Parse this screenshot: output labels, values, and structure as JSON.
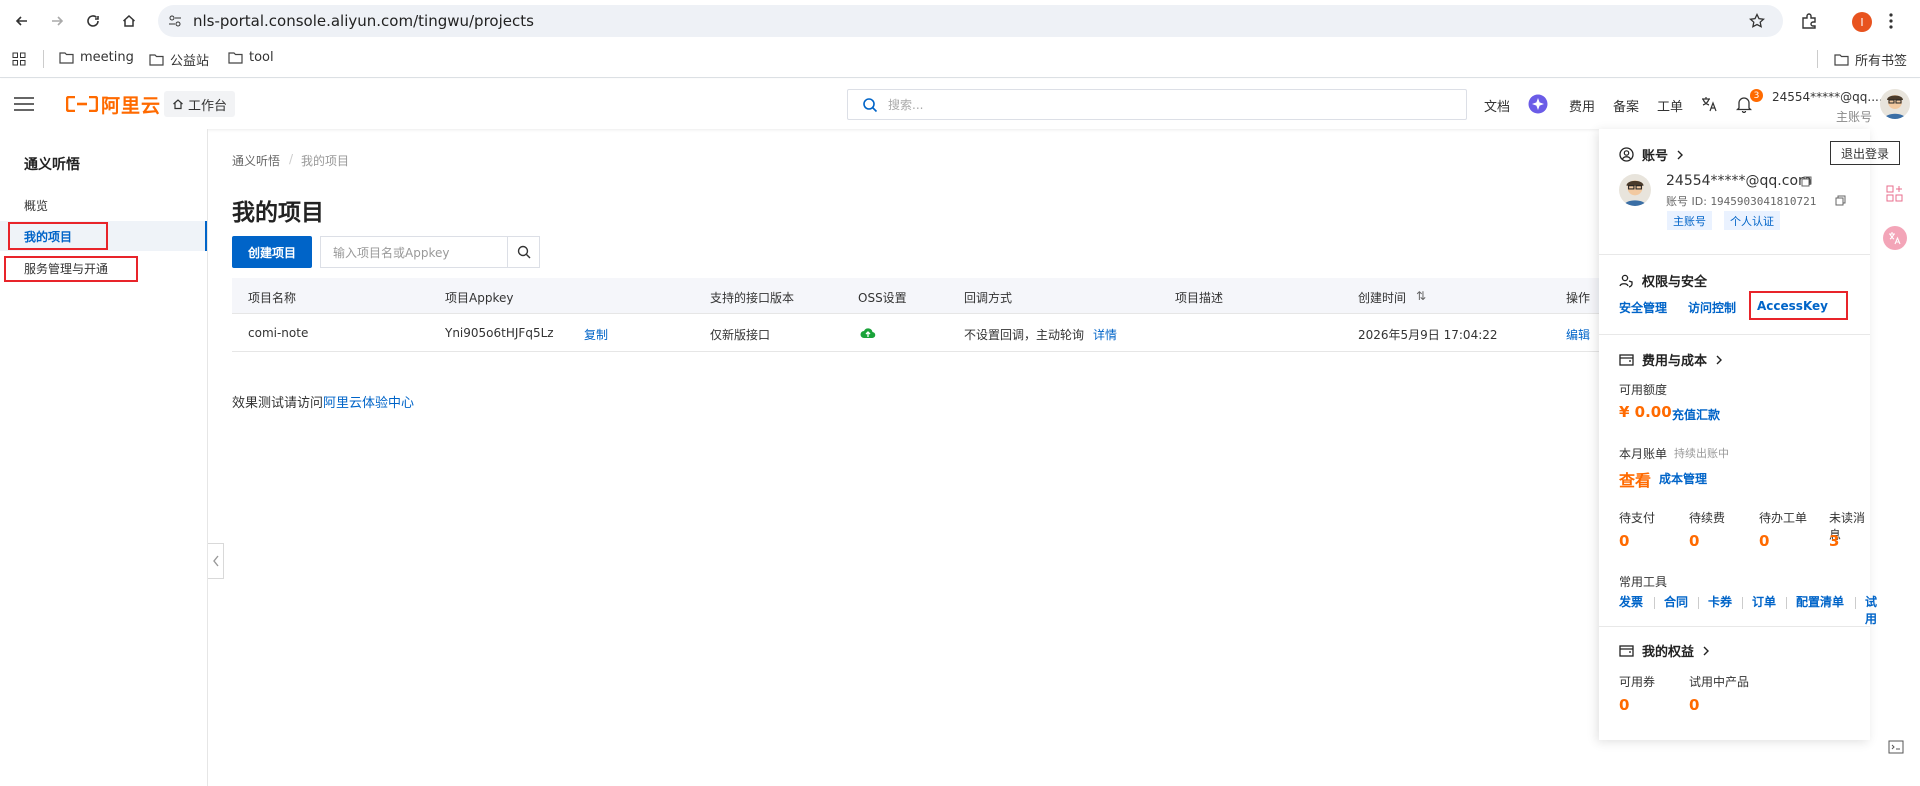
{
  "browser": {
    "url": "nls-portal.console.aliyun.com/tingwu/projects",
    "profile_initial": "I",
    "bookmarks": [
      {
        "label": "meeting"
      },
      {
        "label": "公益站"
      },
      {
        "label": "tool"
      }
    ],
    "all_bookmarks": "所有书签"
  },
  "header": {
    "logo": "阿里云",
    "workbench": "工作台",
    "search_placeholder": "搜索...",
    "links": [
      "文档",
      "费用",
      "备案",
      "工单"
    ],
    "notification_count": "3",
    "user_email_short": "24554*****@qq....",
    "user_role": "主账号"
  },
  "sidebar": {
    "title": "通义听悟",
    "items": [
      {
        "label": "概览"
      },
      {
        "label": "我的项目"
      },
      {
        "label": "服务管理与开通"
      }
    ]
  },
  "main": {
    "breadcrumb": [
      "通义听悟",
      "我的项目"
    ],
    "breadcrumb_sep": "/",
    "title": "我的项目",
    "create_button": "创建项目",
    "search_placeholder": "输入项目名或Appkey",
    "columns": [
      "项目名称",
      "项目Appkey",
      "支持的接口版本",
      "OSS设置",
      "回调方式",
      "项目描述",
      "创建时间",
      "操作"
    ],
    "sort_icon": "⇅",
    "rows": [
      {
        "name": "comi-note",
        "appkey": "Yni905o6tHJFq5Lz",
        "copy": "复制",
        "api_version": "仅新版接口",
        "callback": "不设置回调，主动轮询",
        "detail": "详情",
        "description": "",
        "created": "2026年5月9日 17:04:22",
        "action": "编辑"
      }
    ],
    "footer_text": "效果测试请访问",
    "footer_link": "阿里云体验中心"
  },
  "account_panel": {
    "section_account": "账号",
    "logout": "退出登录",
    "email": "24554*****@qq.com",
    "account_id_label": "账号 ID:",
    "account_id": "1945903041810721",
    "tags": [
      "主账号",
      "个人认证"
    ],
    "section_security": "权限与安全",
    "security_links": [
      "安全管理",
      "访问控制",
      "AccessKey"
    ],
    "section_billing": "费用与成本",
    "available_label": "可用额度",
    "available_value": "¥ 0.00",
    "recharge": "充值汇款",
    "monthly_bill_label": "本月账单",
    "monthly_bill_status": "持续出账中",
    "view": "查看",
    "cost_mgmt": "成本管理",
    "stats": [
      {
        "label": "待支付",
        "value": "0"
      },
      {
        "label": "待续费",
        "value": "0"
      },
      {
        "label": "待办工单",
        "value": "0"
      },
      {
        "label": "未读消息",
        "value": "3"
      }
    ],
    "tools_label": "常用工具",
    "tools": [
      "发票",
      "合同",
      "卡券",
      "订单",
      "配置清单",
      "试用"
    ],
    "section_rights": "我的权益",
    "rights": [
      {
        "label": "可用券",
        "value": "0"
      },
      {
        "label": "试用中产品",
        "value": "0"
      }
    ]
  },
  "colors": {
    "accent": "#0064c8",
    "brand": "#ff6a00",
    "highlight": "#e8242a"
  }
}
